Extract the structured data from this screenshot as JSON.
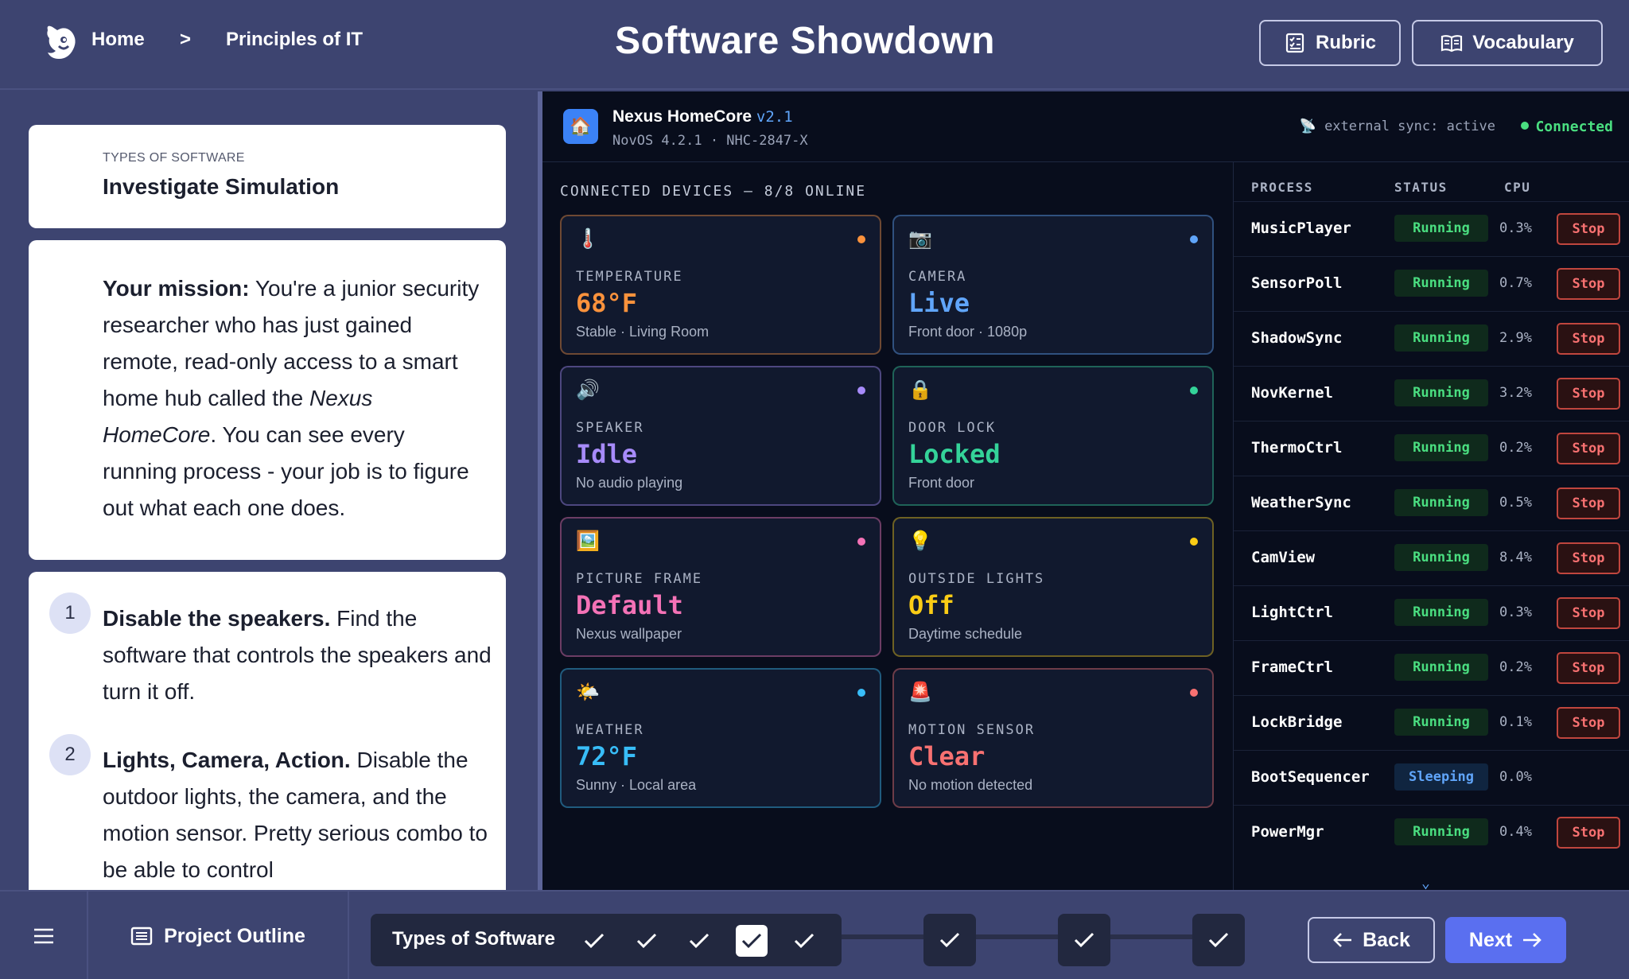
{
  "header": {
    "breadcrumb_home": "Home",
    "breadcrumb_separator": ">",
    "breadcrumb_current": "Principles of IT",
    "title": "Software Showdown",
    "rubric_label": "Rubric",
    "vocabulary_label": "Vocabulary"
  },
  "left": {
    "eyebrow": "TYPES OF SOFTWARE",
    "card_title": "Investigate Simulation",
    "mission_label": "Your mission:",
    "mission_text_1": " You're a junior security researcher who has just gained remote, read-only access to a smart home hub called the ",
    "mission_emph": "Nexus HomeCore",
    "mission_text_2": ". You can see every running process - your job is to figure out what each one does.",
    "steps": [
      {
        "num": "1",
        "title": "Disable the speakers.",
        "text": " Find the software that controls the speakers and turn it off."
      },
      {
        "num": "2",
        "title": "Lights, Camera, Action.",
        "text": " Disable the outdoor lights, the camera, and the motion sensor. Pretty serious combo to be able to control"
      }
    ]
  },
  "sim": {
    "app_name": "Nexus HomeCore",
    "app_version": "v2.1",
    "app_sub": "NovOS 4.2.1 · NHC-2847-X",
    "sync_text": "external sync: active",
    "connection_status": "Connected",
    "devices_header": "CONNECTED DEVICES — 8/8 ONLINE",
    "devices": [
      {
        "icon": "thermometer-icon",
        "glyph": "🌡️",
        "label": "TEMPERATURE",
        "value": "68°F",
        "sub": "Stable · Living Room",
        "color": "#fb923c"
      },
      {
        "icon": "camera-icon",
        "glyph": "📷",
        "label": "CAMERA",
        "value": "Live",
        "sub": "Front door · 1080p",
        "color": "#60a5fa"
      },
      {
        "icon": "speaker-icon",
        "glyph": "🔊",
        "label": "SPEAKER",
        "value": "Idle",
        "sub": "No audio playing",
        "color": "#a78bfa"
      },
      {
        "icon": "lock-icon",
        "glyph": "🔒",
        "label": "DOOR LOCK",
        "value": "Locked",
        "sub": "Front door",
        "color": "#34d399"
      },
      {
        "icon": "picture-frame-icon",
        "glyph": "🖼️",
        "label": "PICTURE FRAME",
        "value": "Default",
        "sub": "Nexus wallpaper",
        "color": "#f472b6"
      },
      {
        "icon": "lightbulb-icon",
        "glyph": "💡",
        "label": "OUTSIDE LIGHTS",
        "value": "Off",
        "sub": "Daytime schedule",
        "color": "#facc15"
      },
      {
        "icon": "weather-icon",
        "glyph": "🌤️",
        "label": "WEATHER",
        "value": "72°F",
        "sub": "Sunny · Local area",
        "color": "#38bdf8"
      },
      {
        "icon": "siren-icon",
        "glyph": "🚨",
        "label": "MOTION SENSOR",
        "value": "Clear",
        "sub": "No motion detected",
        "color": "#f87171"
      }
    ],
    "process_headers": {
      "process": "PROCESS",
      "status": "STATUS",
      "cpu": "CPU"
    },
    "stop_label": "Stop",
    "processes": [
      {
        "name": "MusicPlayer",
        "status": "Running",
        "cpu": "0.3%",
        "stoppable": true
      },
      {
        "name": "SensorPoll",
        "status": "Running",
        "cpu": "0.7%",
        "stoppable": true
      },
      {
        "name": "ShadowSync",
        "status": "Running",
        "cpu": "2.9%",
        "stoppable": true
      },
      {
        "name": "NovKernel",
        "status": "Running",
        "cpu": "3.2%",
        "stoppable": true
      },
      {
        "name": "ThermoCtrl",
        "status": "Running",
        "cpu": "0.2%",
        "stoppable": true
      },
      {
        "name": "WeatherSync",
        "status": "Running",
        "cpu": "0.5%",
        "stoppable": true
      },
      {
        "name": "CamView",
        "status": "Running",
        "cpu": "8.4%",
        "stoppable": true
      },
      {
        "name": "LightCtrl",
        "status": "Running",
        "cpu": "0.3%",
        "stoppable": true
      },
      {
        "name": "FrameCtrl",
        "status": "Running",
        "cpu": "0.2%",
        "stoppable": true
      },
      {
        "name": "LockBridge",
        "status": "Running",
        "cpu": "0.1%",
        "stoppable": true
      },
      {
        "name": "BootSequencer",
        "status": "Sleeping",
        "cpu": "0.0%",
        "stoppable": false
      },
      {
        "name": "PowerMgr",
        "status": "Running",
        "cpu": "0.4%",
        "stoppable": true
      }
    ],
    "scroll_indicator": "⌄"
  },
  "footer": {
    "outline_label": "Project Outline",
    "section_label": "Types of Software",
    "back_label": "Back",
    "next_label": "Next"
  }
}
